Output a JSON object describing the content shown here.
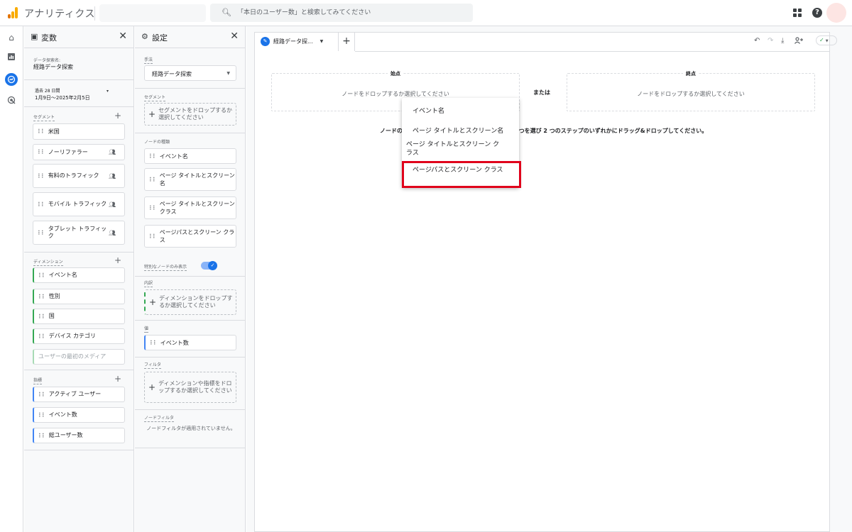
{
  "app": {
    "title": "アナリティクス",
    "brand_colors": [
      "#f9ab00",
      "#e37400"
    ]
  },
  "search": {
    "placeholder": "「本日のユーザー数」と検索してみてください"
  },
  "variables_panel": {
    "title": "変数",
    "exploration_name_label": "データ探索名:",
    "exploration_name": "経路データ探索",
    "date_range_label": "過去 28 日間",
    "date_range": "1月9日～2025年2月5日",
    "segments_label": "セグメント",
    "segments": [
      {
        "label": "米国",
        "user_icon": false
      },
      {
        "label": "ノーリファラー",
        "user_icon": true
      },
      {
        "label": "有料のトラフィック",
        "user_icon": true
      },
      {
        "label": "モバイル トラフィック",
        "user_icon": true
      },
      {
        "label": "タブレット トラフィック",
        "user_icon": true
      }
    ],
    "dimensions_label": "ディメンション",
    "dimensions": [
      "イベント名",
      "性別",
      "国",
      "デバイス カテゴリ",
      "ユーザーの最初のメディア"
    ],
    "metrics_label": "指標",
    "metrics": [
      "アクティブ ユーザー",
      "イベント数",
      "総ユーザー数"
    ]
  },
  "settings_panel": {
    "title": "設定",
    "technique_label": "手法",
    "technique_value": "経路データ探索",
    "segment_label": "セグメント",
    "segment_drop": "セグメントをドロップするか選択してください",
    "node_type_label": "ノードの種類",
    "node_types": [
      "イベント名",
      "ページ タイトルとスクリーン名",
      "ページ タイトルとスクリーン クラス",
      "ページパスとスクリーン クラス"
    ],
    "unique_nodes_label": "特別なノードのみ表示",
    "unique_nodes_on": true,
    "breakdown_label": "内訳",
    "breakdown_drop": "ディメンションをドロップするか選択してください",
    "value_label": "値",
    "value_metric": "イベント数",
    "filter_label": "フィルタ",
    "filter_drop": "ディメンションや指標をドロップするか選択してください",
    "node_filter_label": "ノードフィルタ",
    "node_filter_text": "ノードフィルタが適用されていません。"
  },
  "main": {
    "tab_label": "経路データ探...",
    "start_label": "始点",
    "end_label": "終点",
    "drop_hint": "ノードをドロップするか選択してください",
    "or_label": "または",
    "instruction_prefix": "ノードの",
    "instruction_suffix": "つを選び 2 つのステップのいずれかにドラッグ&ドロップしてください。"
  },
  "dropdown": {
    "items": [
      "イベント名",
      "ページ タイトルとスクリーン名",
      "ページ タイトルとスクリーン ク\nラス",
      "ページパスとスクリーン クラス"
    ],
    "highlighted_index": 3,
    "highlight_color": "#e0001b"
  },
  "icons": {
    "rail": [
      "home-icon",
      "reports-icon",
      "explore-icon",
      "advertising-icon"
    ],
    "toolbar": [
      "undo-icon",
      "redo-icon",
      "download-icon",
      "share-icon",
      "check-icon"
    ]
  }
}
